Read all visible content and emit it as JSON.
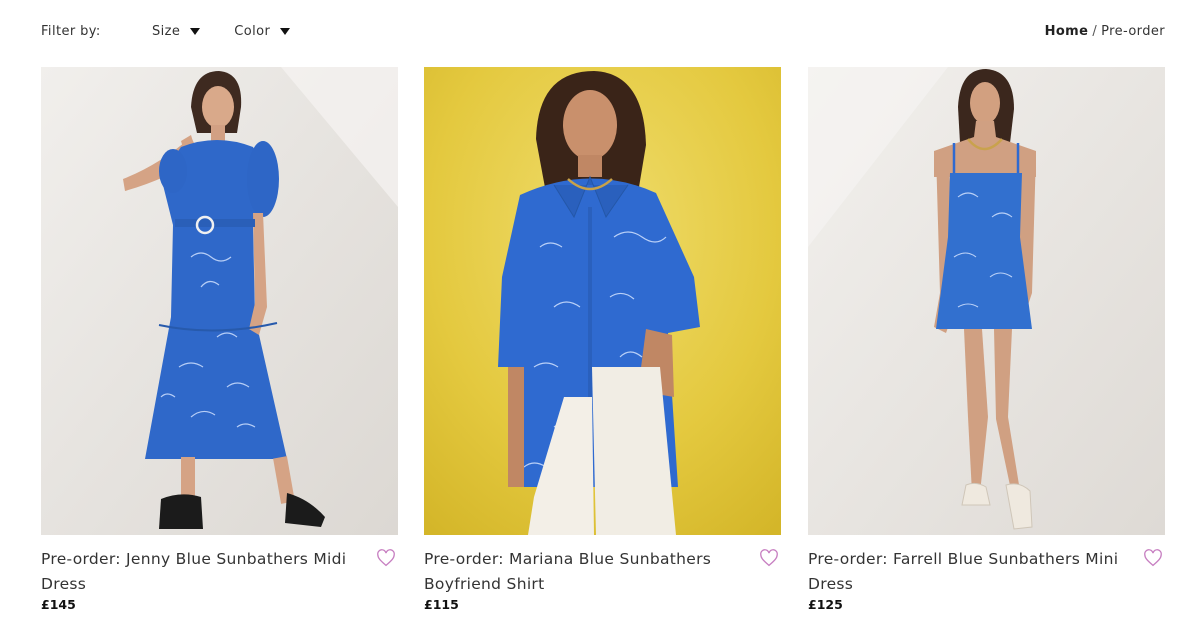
{
  "filters": {
    "label": "Filter by:",
    "size_label": "Size",
    "color_label": "Color"
  },
  "breadcrumb": {
    "home": "Home",
    "separator": "/",
    "current": "Pre-order"
  },
  "products": [
    {
      "title": "Pre-order: Jenny Blue Sunbathers Midi Dress",
      "price": "£145",
      "wishlist_icon": "heart-outline-icon",
      "background_color": "#e9e6e2",
      "garment_color": "#2f68c9"
    },
    {
      "title": "Pre-order: Mariana Blue Sunbathers Boyfriend Shirt",
      "price": "£115",
      "wishlist_icon": "heart-outline-icon",
      "background_color": "#e5cd45",
      "garment_color": "#2f6ad0"
    },
    {
      "title": "Pre-order: Farrell Blue Sunbathers Mini Dress",
      "price": "£125",
      "wishlist_icon": "heart-outline-icon",
      "background_color": "#ebe9e6",
      "garment_color": "#3270cf"
    }
  ],
  "colors": {
    "heart": "#c77fc1",
    "text": "#333333"
  }
}
